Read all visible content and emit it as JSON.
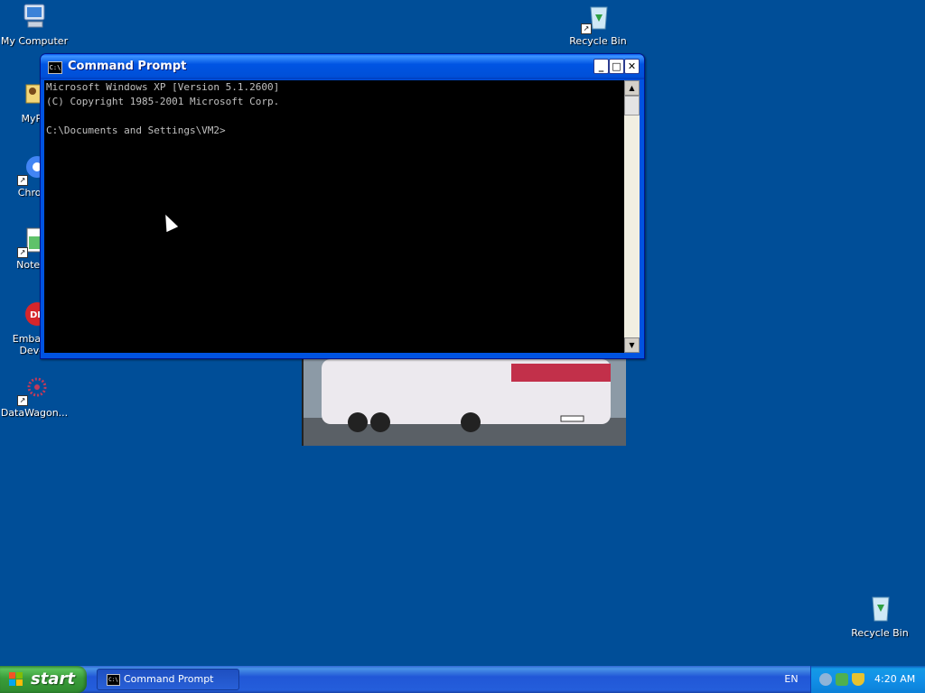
{
  "desktop": {
    "icons": [
      {
        "label": "My Computer"
      },
      {
        "label": "MyPa"
      },
      {
        "label": "Chrom"
      },
      {
        "label": "Notepa"
      },
      {
        "label": "Embarca"
      },
      {
        "label": "Dev-C"
      },
      {
        "label": "DataWagon..."
      },
      {
        "label": "Recycle Bin"
      },
      {
        "label": "Recycle Bin"
      }
    ]
  },
  "window": {
    "title": "Command Prompt",
    "icon_text": "C:\\",
    "minimize": "_",
    "maximize": "□",
    "close": "✕",
    "lines": [
      "Microsoft Windows XP [Version 5.1.2600]",
      "(C) Copyright 1985-2001 Microsoft Corp.",
      "",
      "C:\\Documents and Settings\\VM2>"
    ],
    "scroll_up": "▲",
    "scroll_down": "▼"
  },
  "taskbar": {
    "start_label": "start",
    "task_label": "Command Prompt",
    "task_icon_text": "C:\\",
    "language": "EN",
    "clock": "4:20 AM"
  },
  "colors": {
    "desktop": "#004e98",
    "start_green": "#3a9d3a",
    "titlebar_blue": "#0054e3"
  }
}
